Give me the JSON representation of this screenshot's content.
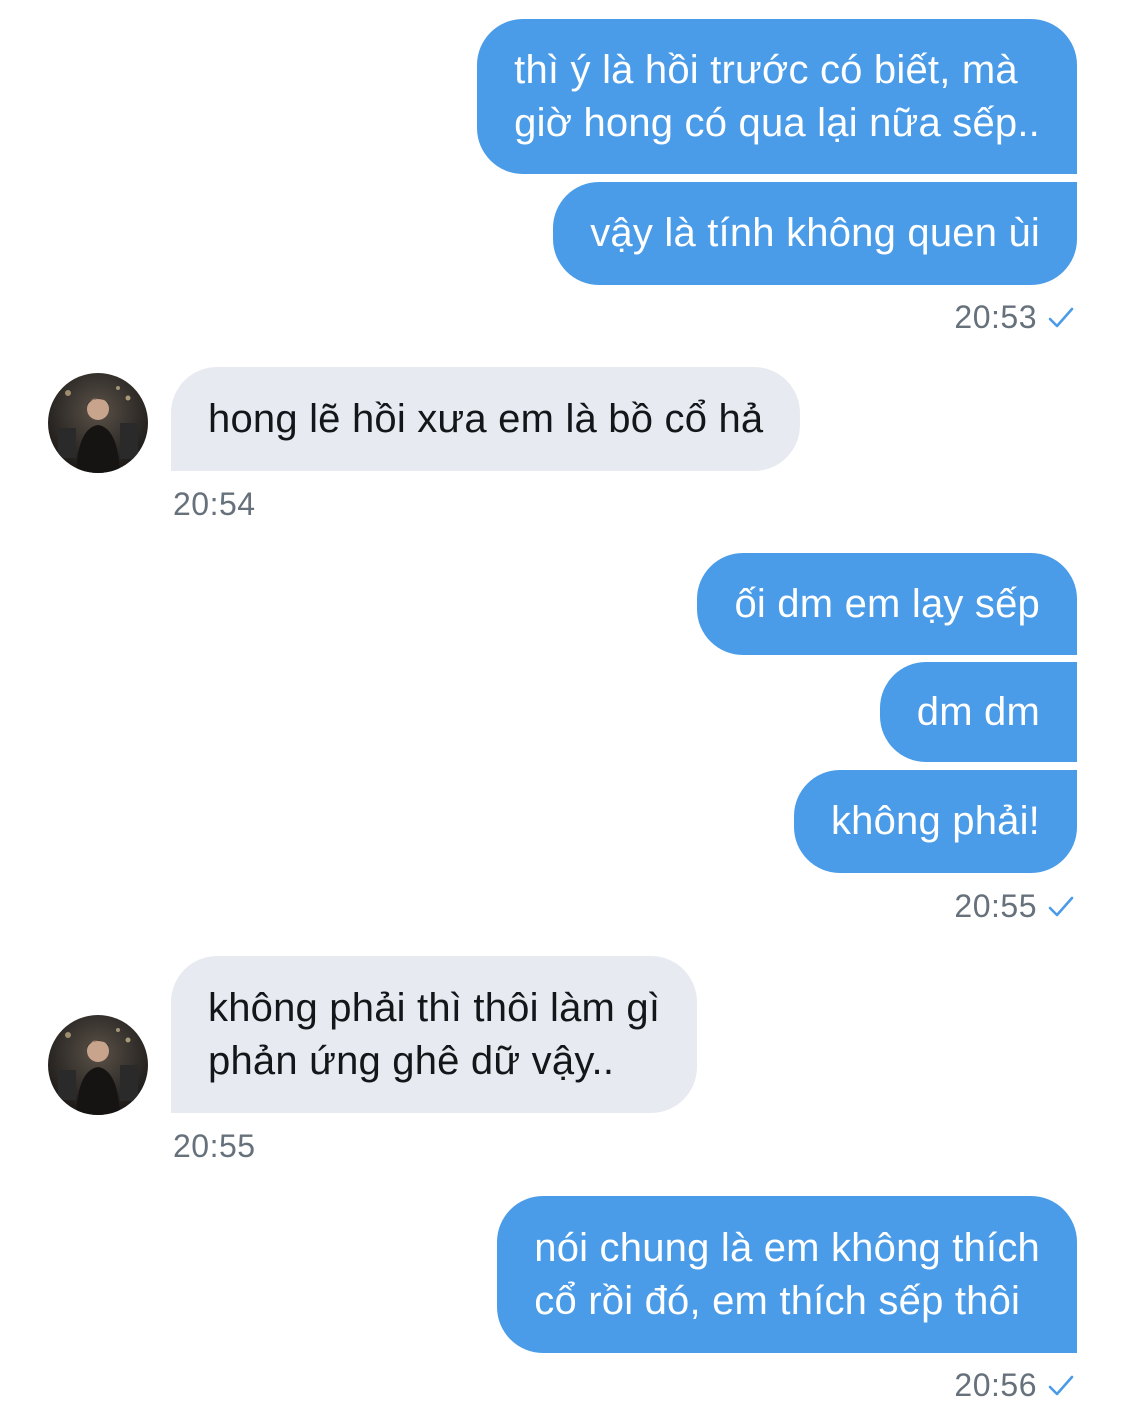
{
  "messages": [
    {
      "direction": "out",
      "lines": [
        "thì ý là hồi trước có biết, mà",
        "giờ hong có qua lại nữa sếp.."
      ]
    },
    {
      "direction": "out",
      "lines": [
        "vậy là tính không quen ùi"
      ]
    },
    {
      "direction": "out",
      "time": "20:53",
      "status_icon": "checkmark-icon"
    },
    {
      "direction": "in",
      "lines": [
        "hong lẽ hồi xưa em là bồ cổ hả"
      ],
      "time": "20:54",
      "avatar": "contact-avatar"
    },
    {
      "direction": "out",
      "lines": [
        "ối dm em lạy sếp"
      ]
    },
    {
      "direction": "out",
      "lines": [
        "dm dm"
      ]
    },
    {
      "direction": "out",
      "lines": [
        "không phải!"
      ],
      "time": "20:55",
      "status_icon": "checkmark-icon"
    },
    {
      "direction": "in",
      "lines": [
        "không phải thì thôi làm gì",
        "phản ứng ghê dữ vậy.."
      ],
      "time": "20:55",
      "avatar": "contact-avatar"
    },
    {
      "direction": "out",
      "lines": [
        "nói chung là em không thích",
        "cổ rồi đó, em thích sếp thôi"
      ],
      "time": "20:56",
      "status_icon": "checkmark-icon"
    }
  ],
  "colors": {
    "outgoing_bubble": "#4a9be8",
    "incoming_bubble": "#e7eaf0",
    "timestamp": "#66717c",
    "check": "#4a9be8"
  }
}
